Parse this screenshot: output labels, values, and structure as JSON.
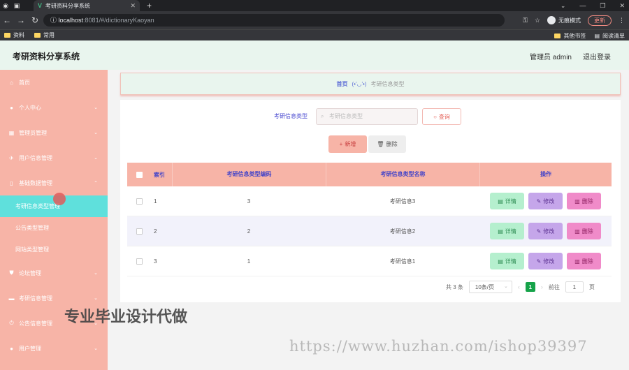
{
  "browser": {
    "tab_title": "考研资料分享系统",
    "new_tab": "+",
    "url_host": "localhost",
    "url_path": ":8081/#/dictionaryKaoyan",
    "incognito_label": "无痕模式",
    "update_label": "更新",
    "bookmarks": [
      "资料",
      "常用"
    ],
    "bookmarks_right": [
      "其他书签",
      "阅读清单"
    ]
  },
  "header": {
    "title": "考研资料分享系统",
    "user_label": "管理员 admin",
    "logout_label": "退出登录"
  },
  "sidebar": {
    "items": [
      {
        "label": "首页",
        "icon": "home-icon"
      },
      {
        "label": "个人中心",
        "icon": "user-icon"
      },
      {
        "label": "管理员管理",
        "icon": "calendar-icon"
      },
      {
        "label": "用户信息管理",
        "icon": "pin-icon"
      },
      {
        "label": "基础数据管理",
        "icon": "phone-icon"
      },
      {
        "label": "论坛管理",
        "icon": "shield-icon"
      },
      {
        "label": "考研信息管理",
        "icon": "chat-icon"
      },
      {
        "label": "公告信息管理",
        "icon": "power-icon"
      },
      {
        "label": "用户管理",
        "icon": "user-icon"
      }
    ],
    "sub_items": [
      "考研信息类型管理",
      "公告类型管理",
      "网站类型管理"
    ]
  },
  "breadcrumb": {
    "home": "首页",
    "face": "(•'◡'•)",
    "current": "考研信息类型"
  },
  "search": {
    "label": "考研信息类型",
    "placeholder": "考研信息类型",
    "query_button": "查询"
  },
  "actions": {
    "add": "新增",
    "delete": "删除"
  },
  "table": {
    "headers": {
      "index": "索引",
      "code": "考研信息类型编码",
      "name": "考研信息类型名称",
      "ops": "操作"
    },
    "rows": [
      {
        "index": "1",
        "code": "3",
        "name": "考研信息3"
      },
      {
        "index": "2",
        "code": "2",
        "name": "考研信息2"
      },
      {
        "index": "3",
        "code": "1",
        "name": "考研信息1"
      }
    ],
    "op_labels": {
      "detail": "详情",
      "edit": "修改",
      "delete": "删除"
    }
  },
  "pagination": {
    "total": "共 3 条",
    "page_size": "10条/页",
    "current_page": "1",
    "goto_label": "前往",
    "goto_value": "1",
    "page_suffix": "页"
  },
  "watermark": {
    "service": "专业毕业设计代做",
    "url": "https://www.huzhan.com/ishop39397"
  },
  "colors": {
    "sidebar_bg": "#f7b4a7",
    "active_sub": "#5fe0dc",
    "header_bg": "#e9f5ee",
    "pager_active": "#16a34a"
  }
}
